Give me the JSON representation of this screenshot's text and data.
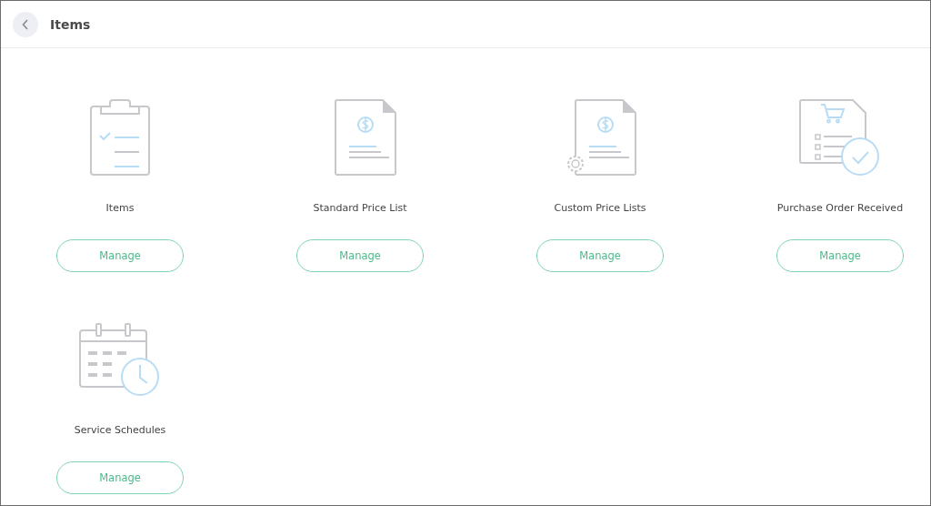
{
  "header": {
    "title": "Items"
  },
  "cards": [
    {
      "kind": "clipboard",
      "title": "Items",
      "button": "Manage"
    },
    {
      "kind": "price-document",
      "title": "Standard Price List",
      "button": "Manage"
    },
    {
      "kind": "custom-price-document",
      "title": "Custom Price Lists",
      "button": "Manage"
    },
    {
      "kind": "purchase-order",
      "title": "Purchase Order Received",
      "button": "Manage"
    },
    {
      "kind": "schedule",
      "title": "Service Schedules",
      "button": "Manage"
    }
  ]
}
